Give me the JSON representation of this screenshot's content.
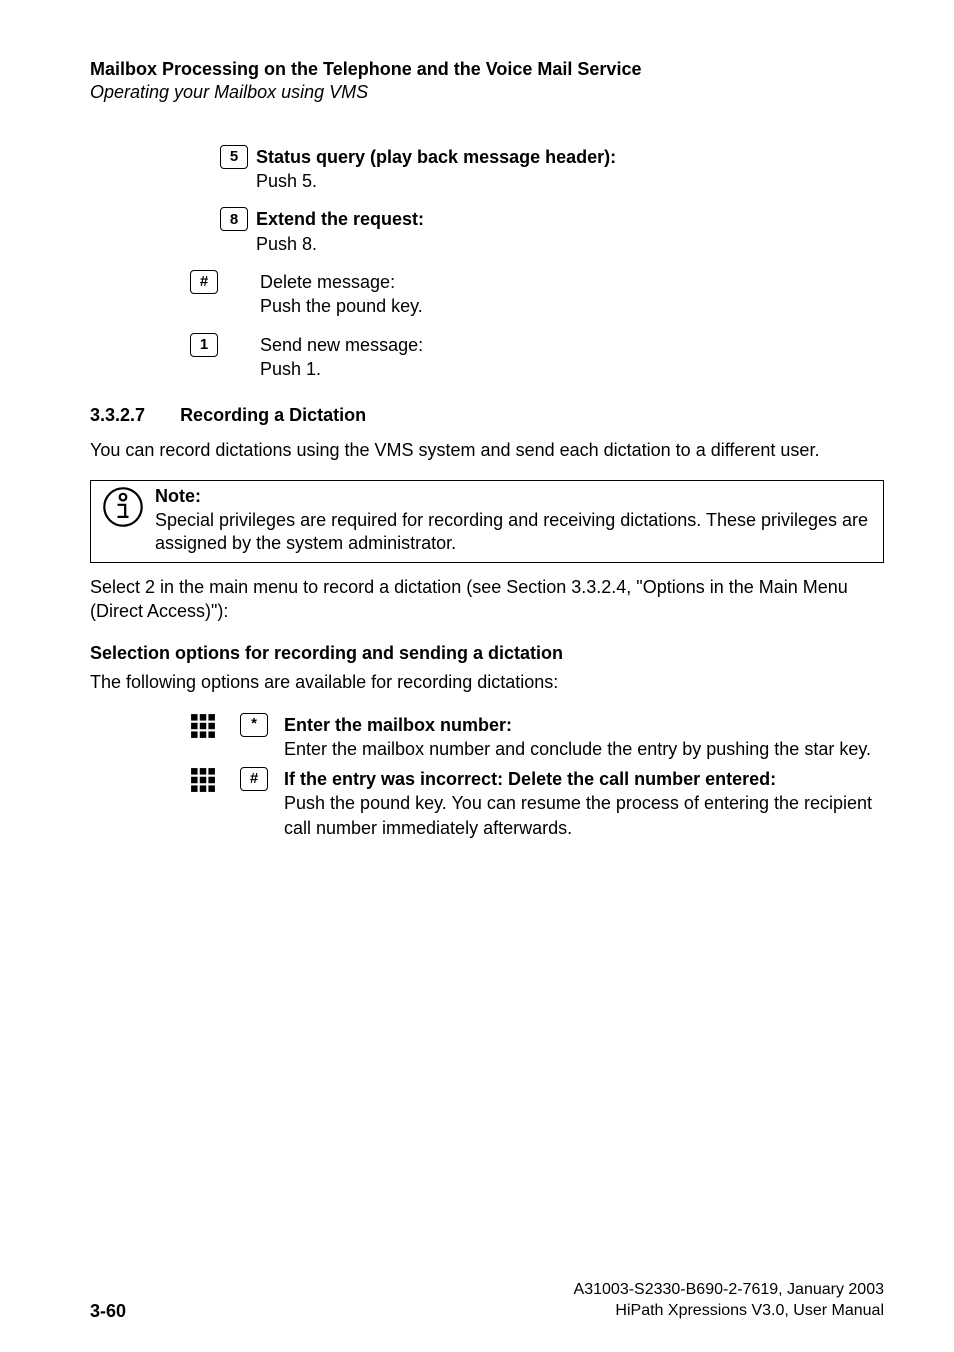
{
  "header": {
    "title": "Mailbox Processing on the Telephone and the Voice Mail Service",
    "subtitle": "Operating your Mailbox using VMS"
  },
  "commands": {
    "c5": {
      "key": "5",
      "label_bold": "Status query (play back message header):",
      "label_rest": "Push 5."
    },
    "c8": {
      "key": "8",
      "label_bold": "Extend the request:",
      "label_rest": "Push 8."
    },
    "chash": {
      "key": "#",
      "label_line1": "Delete message:",
      "label_line2": "Push the pound key."
    },
    "c1": {
      "key": "1",
      "label_line1": "Send new message:",
      "label_line2": "Push 1."
    }
  },
  "section": {
    "number": "3.3.2.7",
    "title": "Recording a Dictation",
    "intro": "You can record dictations using the VMS system and send each dictation to a different user."
  },
  "note": {
    "heading": "Note:",
    "body": "Special privileges are required for recording and receiving dictations. These privileges are assigned by the system administrator."
  },
  "select_intro": "Select 2 in the main menu to record a dictation (see Section 3.3.2.4, \"Options in the Main Menu (Direct Access)\"):",
  "selection_heading": "Selection options for recording and sending a dictation",
  "options_intro": "The following options are available for recording dictations:",
  "opt1": {
    "key_label": "*",
    "bold_line": "Enter the mailbox number:",
    "body": "Enter the mailbox number and conclude the entry by pushing the star key."
  },
  "opt2": {
    "key_label": "#",
    "bold_line": "If the entry was incorrect: Delete the call number entered:",
    "body": "Push the pound key. You can resume the process of entering the recipient call number immediately afterwards."
  },
  "footer": {
    "page_num": "3-60",
    "doc_id": "A31003-S2330-B690-2-7619, January 2003",
    "product": "HiPath Xpressions V3.0, User Manual"
  }
}
